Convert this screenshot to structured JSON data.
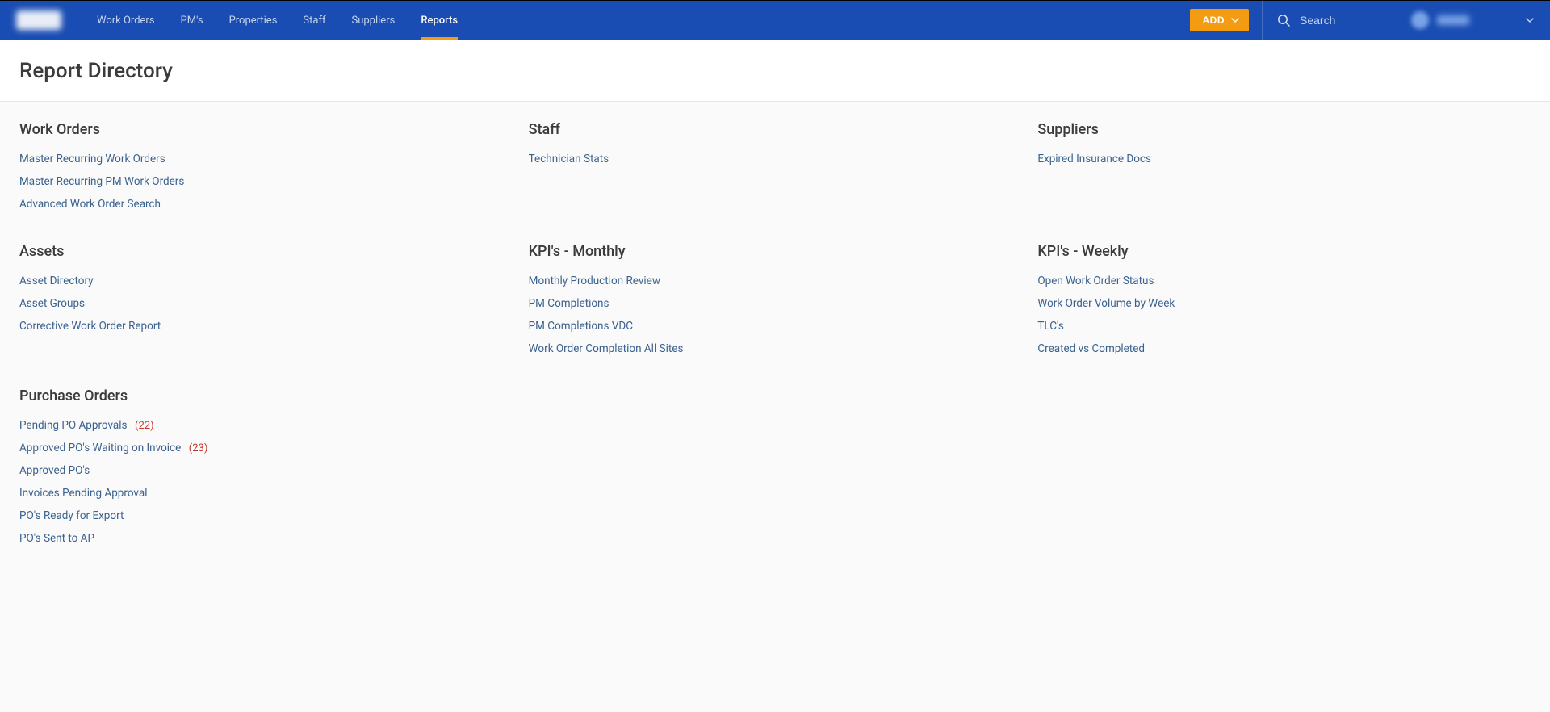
{
  "header": {
    "nav": {
      "items": [
        {
          "label": "Work Orders",
          "active": false
        },
        {
          "label": "PM's",
          "active": false
        },
        {
          "label": "Properties",
          "active": false
        },
        {
          "label": "Staff",
          "active": false
        },
        {
          "label": "Suppliers",
          "active": false
        },
        {
          "label": "Reports",
          "active": true
        }
      ]
    },
    "add_button_label": "ADD",
    "search_placeholder": "Search"
  },
  "page": {
    "title": "Report Directory"
  },
  "groups": [
    {
      "title": "Work Orders",
      "links": [
        {
          "label": "Master Recurring Work Orders"
        },
        {
          "label": "Master Recurring PM Work Orders"
        },
        {
          "label": "Advanced Work Order Search"
        }
      ]
    },
    {
      "title": "Staff",
      "links": [
        {
          "label": "Technician Stats"
        }
      ]
    },
    {
      "title": "Suppliers",
      "links": [
        {
          "label": "Expired Insurance Docs"
        }
      ]
    },
    {
      "title": "Assets",
      "links": [
        {
          "label": "Asset Directory"
        },
        {
          "label": "Asset Groups"
        },
        {
          "label": "Corrective Work Order Report"
        }
      ]
    },
    {
      "title": "KPI's - Monthly",
      "links": [
        {
          "label": "Monthly Production Review"
        },
        {
          "label": "PM Completions"
        },
        {
          "label": "PM Completions VDC"
        },
        {
          "label": "Work Order Completion All Sites"
        }
      ]
    },
    {
      "title": "KPI's - Weekly",
      "links": [
        {
          "label": "Open Work Order Status"
        },
        {
          "label": "Work Order Volume by Week"
        },
        {
          "label": "TLC's"
        },
        {
          "label": "Created vs Completed"
        }
      ]
    },
    {
      "title": "Purchase Orders",
      "links": [
        {
          "label": "Pending PO Approvals",
          "count": "(22)"
        },
        {
          "label": "Approved PO's Waiting on Invoice",
          "count": "(23)"
        },
        {
          "label": "Approved PO's"
        },
        {
          "label": "Invoices Pending Approval"
        },
        {
          "label": "PO's Ready for Export"
        },
        {
          "label": "PO's Sent to AP"
        }
      ]
    }
  ]
}
